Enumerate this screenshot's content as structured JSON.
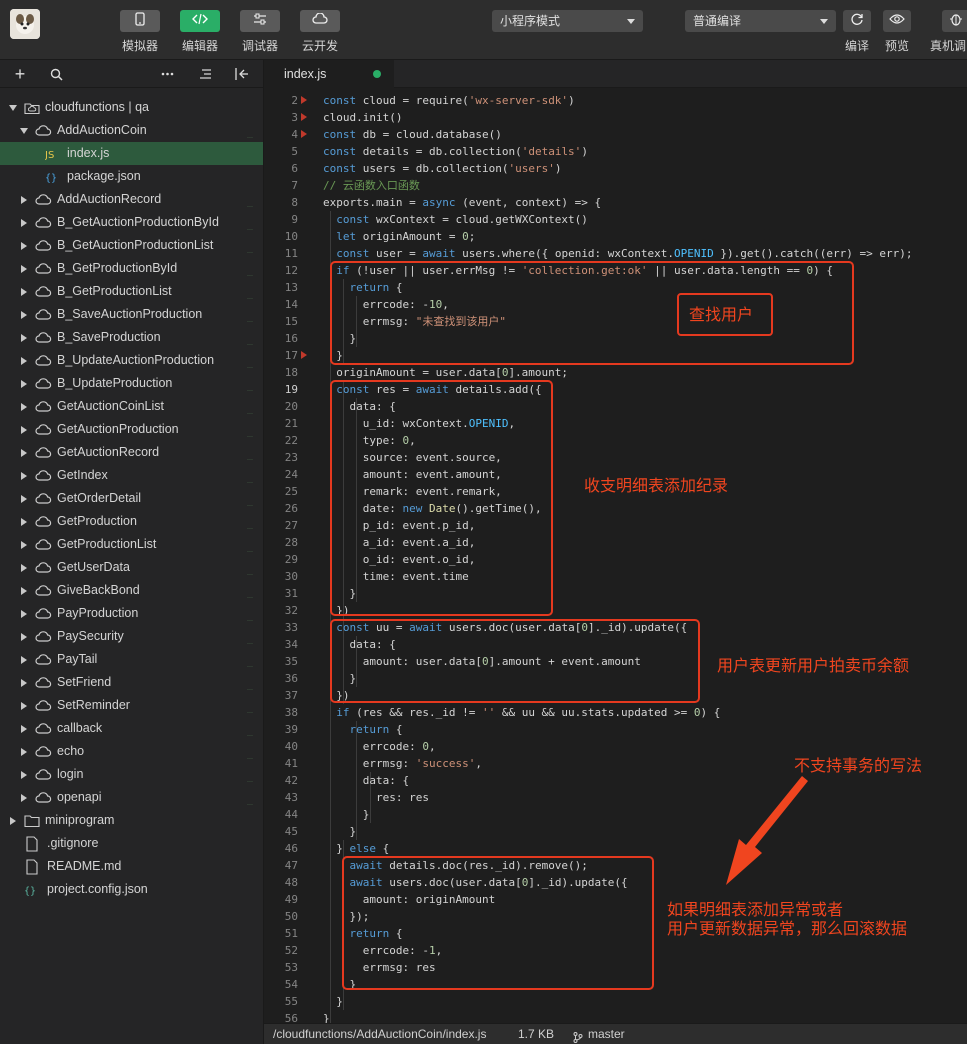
{
  "toolbar": {
    "buttons": [
      {
        "label": "模拟器",
        "icon": "phone-icon"
      },
      {
        "label": "编辑器",
        "icon": "code-icon"
      },
      {
        "label": "调试器",
        "icon": "sliders-icon"
      },
      {
        "label": "云开发",
        "icon": "cloud-link-icon"
      }
    ],
    "mode_select": "小程序模式",
    "compile_select": "普通编译",
    "right_labels": [
      "编译",
      "预览",
      "真机调"
    ]
  },
  "sidebar": {
    "root": "cloudfunctions | qa",
    "items": [
      {
        "label": "AddAuctionCoin",
        "type": "cloud",
        "expanded": true
      },
      {
        "label": "index.js",
        "type": "js"
      },
      {
        "label": "package.json",
        "type": "json"
      },
      {
        "label": "AddAuctionRecord",
        "type": "cloud"
      },
      {
        "label": "B_GetAuctionProductionById",
        "type": "cloud"
      },
      {
        "label": "B_GetAuctionProductionList",
        "type": "cloud"
      },
      {
        "label": "B_GetProductionById",
        "type": "cloud"
      },
      {
        "label": "B_GetProductionList",
        "type": "cloud"
      },
      {
        "label": "B_SaveAuctionProduction",
        "type": "cloud"
      },
      {
        "label": "B_SaveProduction",
        "type": "cloud"
      },
      {
        "label": "B_UpdateAuctionProduction",
        "type": "cloud"
      },
      {
        "label": "B_UpdateProduction",
        "type": "cloud"
      },
      {
        "label": "GetAuctionCoinList",
        "type": "cloud"
      },
      {
        "label": "GetAuctionProduction",
        "type": "cloud"
      },
      {
        "label": "GetAuctionRecord",
        "type": "cloud"
      },
      {
        "label": "GetIndex",
        "type": "cloud"
      },
      {
        "label": "GetOrderDetail",
        "type": "cloud"
      },
      {
        "label": "GetProduction",
        "type": "cloud"
      },
      {
        "label": "GetProductionList",
        "type": "cloud"
      },
      {
        "label": "GetUserData",
        "type": "cloud"
      },
      {
        "label": "GiveBackBond",
        "type": "cloud"
      },
      {
        "label": "PayProduction",
        "type": "cloud"
      },
      {
        "label": "PaySecurity",
        "type": "cloud"
      },
      {
        "label": "PayTail",
        "type": "cloud"
      },
      {
        "label": "SetFriend",
        "type": "cloud"
      },
      {
        "label": "SetReminder",
        "type": "cloud"
      },
      {
        "label": "callback",
        "type": "cloud"
      },
      {
        "label": "echo",
        "type": "cloud"
      },
      {
        "label": "login",
        "type": "cloud"
      },
      {
        "label": "openapi",
        "type": "cloud"
      }
    ],
    "others": [
      {
        "label": "miniprogram",
        "type": "folder"
      },
      {
        "label": ".gitignore",
        "type": "file"
      },
      {
        "label": "README.md",
        "type": "file"
      },
      {
        "label": "project.config.json",
        "type": "json"
      }
    ]
  },
  "editor": {
    "tab": "index.js",
    "first_line": 2,
    "current_line": 19,
    "code": [
      "const cloud = require('wx-server-sdk')",
      "cloud.init()",
      "const db = cloud.database()",
      "const details = db.collection('details')",
      "const users = db.collection('users')",
      "// 云函数入口函数",
      "exports.main = async (event, context) => {",
      "  const wxContext = cloud.getWXContext()",
      "  let originAmount = 0;",
      "  const user = await users.where({ openid: wxContext.OPENID }).get().catch((err) => err);",
      "  if (!user || user.errMsg != 'collection.get:ok' || user.data.length == 0) {",
      "    return {",
      "      errcode: -10,",
      "      errmsg: \"未查找到该用户\"",
      "    }",
      "  }",
      "  originAmount = user.data[0].amount;",
      "  const res = await details.add({",
      "    data: {",
      "      u_id: wxContext.OPENID,",
      "      type: 0,",
      "      source: event.source,",
      "      amount: event.amount,",
      "      remark: event.remark,",
      "      date: new Date().getTime(),",
      "      p_id: event.p_id,",
      "      a_id: event.a_id,",
      "      o_id: event.o_id,",
      "      time: event.time",
      "    }",
      "  })",
      "  const uu = await users.doc(user.data[0]._id).update({",
      "    data: {",
      "      amount: user.data[0].amount + event.amount",
      "    }",
      "  })",
      "  if (res && res._id != '' && uu && uu.stats.updated >= 0) {",
      "    return {",
      "      errcode: 0,",
      "      errmsg: 'success',",
      "      data: {",
      "        res: res",
      "      }",
      "    }",
      "  } else {",
      "    await details.doc(res._id).remove();",
      "    await users.doc(user.data[0]._id).update({",
      "      amount: originAmount",
      "    });",
      "    return {",
      "      errcode: -1,",
      "      errmsg: res",
      "    }",
      "  }",
      "}"
    ]
  },
  "annotations": {
    "find_user": "查找用户",
    "add_record": "收支明细表添加纪录",
    "update_balance": "用户表更新用户拍卖币余额",
    "no_transaction": "不支持事务的写法",
    "rollback_line1": "如果明细表添加异常或者",
    "rollback_line2": "用户更新数据异常，那么回滚数据"
  },
  "statusbar": {
    "path": "/cloudfunctions/AddAuctionCoin/index.js",
    "size": "1.7 KB",
    "branch": "master"
  },
  "colors": {
    "accent_green": "#2aae67",
    "annotation_red": "#e5391f"
  }
}
